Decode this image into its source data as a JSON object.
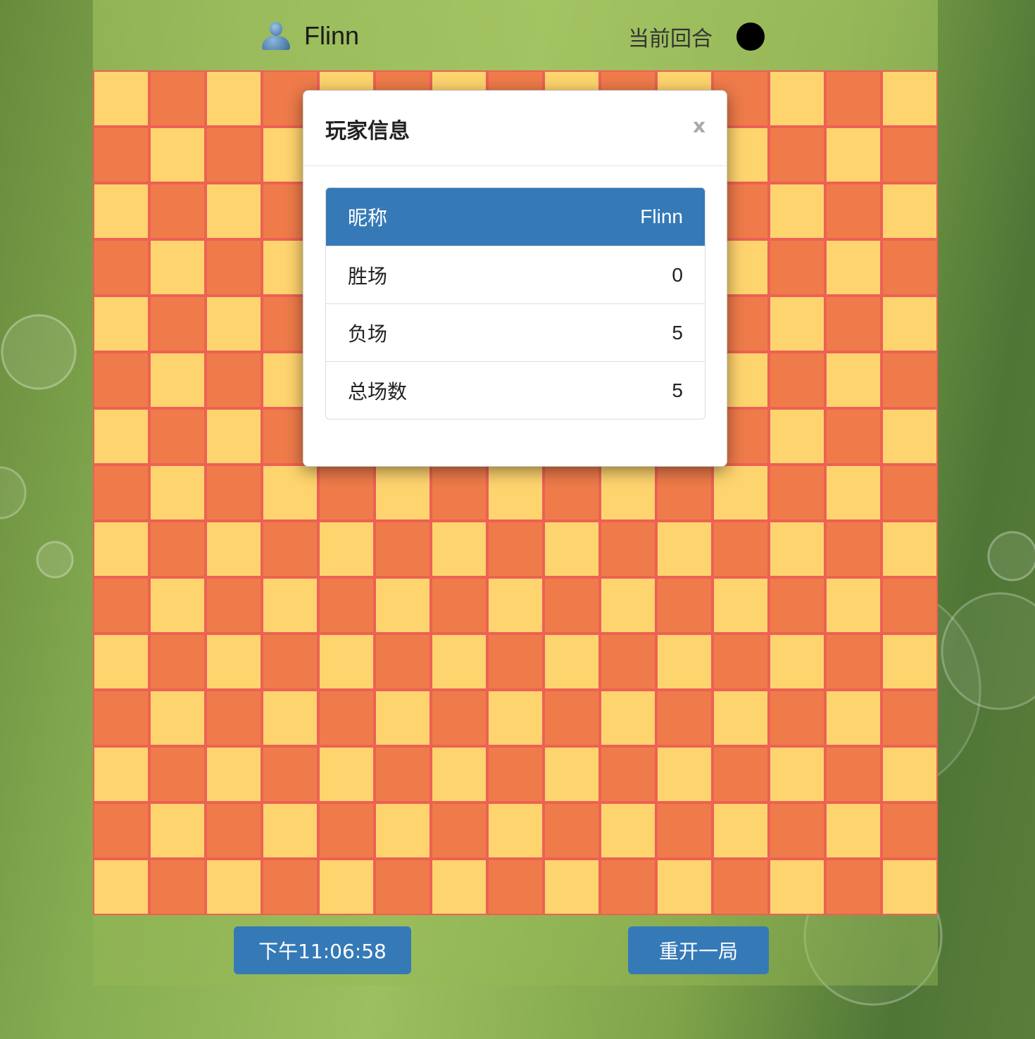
{
  "header": {
    "player_icon": "user-icon",
    "player_name": "Flinn",
    "turn_label": "当前回合",
    "turn_stone_color": "#000000"
  },
  "board": {
    "size": 15,
    "colors": {
      "light": "#fed46e",
      "dark": "#ef7b4a",
      "grid": "#ec6155"
    }
  },
  "footer": {
    "clock_label": "下午11:06:58",
    "restart_label": "重开一局",
    "button_color": "#357ab7"
  },
  "modal": {
    "title": "玩家信息",
    "close_label": "x",
    "rows": [
      {
        "label": "昵称",
        "value": "Flinn"
      },
      {
        "label": "胜场",
        "value": "0"
      },
      {
        "label": "负场",
        "value": "5"
      },
      {
        "label": "总场数",
        "value": "5"
      }
    ]
  }
}
